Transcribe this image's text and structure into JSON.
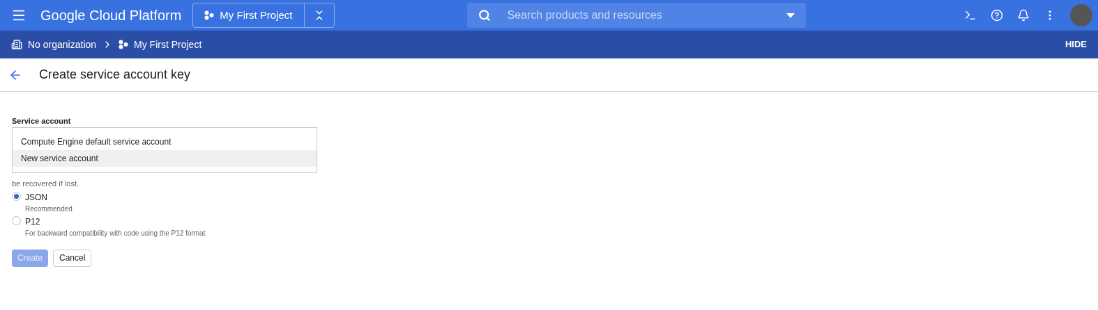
{
  "topbar": {
    "title": "Google Cloud Platform",
    "project": "My First Project",
    "search": {
      "placeholder": "Search products and resources"
    }
  },
  "breadcrumb": {
    "organization": "No organization",
    "project": "My First Project",
    "hide": "HIDE"
  },
  "page": {
    "title": "Create service account key"
  },
  "form": {
    "label": "Service account",
    "options": [
      {
        "label": "Compute Engine default service account",
        "selected": false
      },
      {
        "label": "New service account",
        "selected": true
      }
    ],
    "description": "be recovered if lost.",
    "key_types": [
      {
        "label": "JSON",
        "hint": "Recommended",
        "selected": true
      },
      {
        "label": "P12",
        "hint": "For backward compatibility with code using the P12 format",
        "selected": false
      }
    ],
    "buttons": [
      {
        "label": "Create",
        "kind": "primary",
        "disabled": true
      },
      {
        "label": "Cancel",
        "kind": "secondary",
        "disabled": false
      }
    ]
  }
}
